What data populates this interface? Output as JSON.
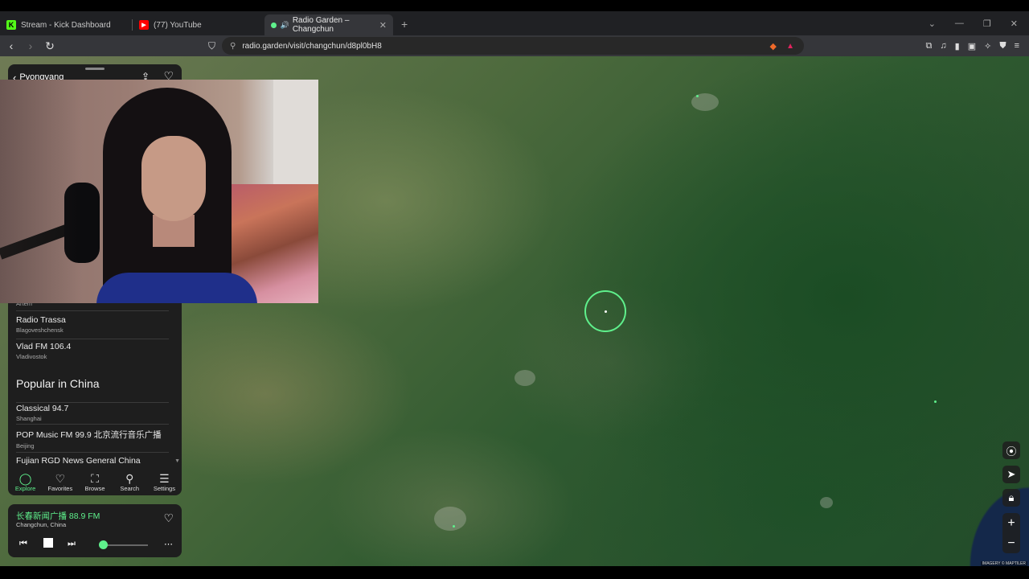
{
  "browser": {
    "tabs": [
      {
        "label": "Stream - Kick Dashboard",
        "icon": "kick-icon",
        "color": "#53fc18"
      },
      {
        "label": "(77) YouTube",
        "icon": "youtube-icon",
        "color": "#ff0000"
      },
      {
        "label": "Radio Garden – Changchun",
        "icon": "radio-garden-icon",
        "color": "#5ff08c"
      }
    ],
    "url": "radio.garden/visit/changchun/d8pl0bH8"
  },
  "panel": {
    "back_label": "Pyongyang",
    "partial_station_loc": "Artem",
    "stations": [
      {
        "name": "Radio Trassa",
        "location": "Blagoveshchensk"
      },
      {
        "name": "Vlad FM 106.4",
        "location": "Vladivostok"
      }
    ],
    "section_title": "Popular in China",
    "china_stations": [
      {
        "name": "Classical 94.7",
        "location": "Shanghai"
      },
      {
        "name": "POP Music FM 99.9 北京流行音乐广播",
        "location": "Beijing"
      },
      {
        "name": "Fujian RGD News General China",
        "location": ""
      }
    ],
    "nav": [
      {
        "label": "Explore",
        "icon": "explore-icon",
        "active": true
      },
      {
        "label": "Favorites",
        "icon": "heart-icon",
        "active": false
      },
      {
        "label": "Browse",
        "icon": "map-icon",
        "active": false
      },
      {
        "label": "Search",
        "icon": "search-icon",
        "active": false
      },
      {
        "label": "Settings",
        "icon": "menu-icon",
        "active": false
      }
    ]
  },
  "player": {
    "station": "长春新闻广播 88.9 FM",
    "location": "Changchun, China",
    "volume": 0.05
  },
  "map": {
    "attribution": "IMAGERY © MAPTILER"
  },
  "colors": {
    "accent": "#5ff08c",
    "panel_bg": "#1e1e1e"
  }
}
